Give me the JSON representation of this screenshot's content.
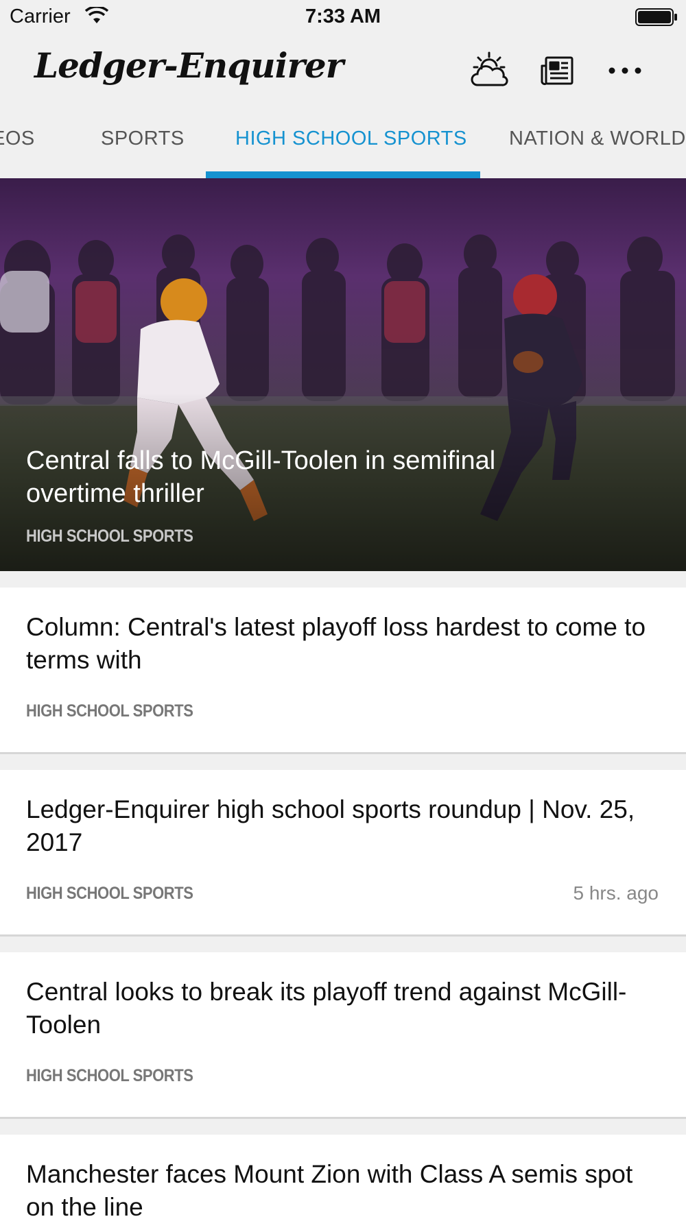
{
  "status_bar": {
    "carrier": "Carrier",
    "time": "7:33 AM"
  },
  "header": {
    "logo": "Ledger-Enquirer",
    "icons": [
      "weather-icon",
      "epaper-icon",
      "more-icon"
    ]
  },
  "tabs": [
    {
      "label": "VIDEOS",
      "visible_label": "EOS"
    },
    {
      "label": "SPORTS"
    },
    {
      "label": "HIGH SCHOOL SPORTS",
      "active": true
    },
    {
      "label": "NATION & WORLD"
    }
  ],
  "hero": {
    "title": "Central falls to McGill-Toolen in semifinal overtime thriller",
    "section": "HIGH SCHOOL SPORTS"
  },
  "articles": [
    {
      "title": "Column: Central's latest playoff loss hardest to come to terms with",
      "section": "HIGH SCHOOL SPORTS",
      "time": ""
    },
    {
      "title": "Ledger-Enquirer high school sports roundup | Nov. 25, 2017",
      "section": "HIGH SCHOOL SPORTS",
      "time": "5 hrs. ago"
    },
    {
      "title": "Central looks to break its playoff trend against McGill-Toolen",
      "section": "HIGH SCHOOL SPORTS",
      "time": ""
    },
    {
      "title": "Manchester faces Mount Zion with Class A semis spot on the line",
      "section": "",
      "time": ""
    }
  ],
  "colors": {
    "accent": "#1592d0",
    "background": "#f0f0f0"
  }
}
